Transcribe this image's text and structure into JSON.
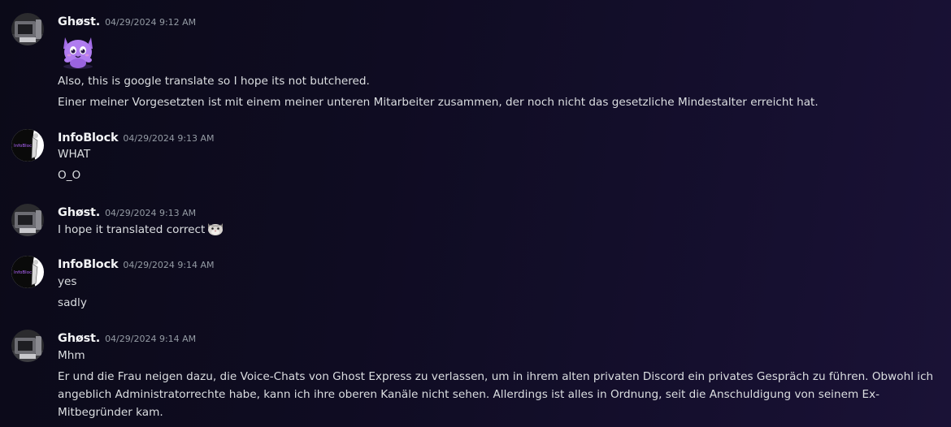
{
  "messages": [
    {
      "author": "Ghøst.",
      "timestamp": "04/29/2024 9:12 AM",
      "sticker": "purple-cat-emoji",
      "lines": [
        "Also, this is google translate so I hope its not butchered.",
        "Einer meiner Vorgesetzten ist mit einem meiner unteren Mitarbeiter zusammen, der noch nicht das gesetzliche Mindestalter erreicht hat."
      ]
    },
    {
      "author": "InfoBlock",
      "timestamp": "04/29/2024 9:13 AM",
      "avatar_text": "InfoBlock",
      "lines": [
        "WHAT",
        "O_O"
      ]
    },
    {
      "author": "Ghøst.",
      "timestamp": "04/29/2024 9:13 AM",
      "lines": [
        "I hope it translated correct"
      ],
      "inline_emoji": "cat-emoji"
    },
    {
      "author": "InfoBlock",
      "timestamp": "04/29/2024 9:14 AM",
      "avatar_text": "InfoBlock",
      "lines": [
        "yes",
        "sadly"
      ]
    },
    {
      "author": "Ghøst.",
      "timestamp": "04/29/2024 9:14 AM",
      "lines": [
        "Mhm",
        "Er und die Frau neigen dazu, die Voice-Chats von Ghost Express zu verlassen, um in ihrem alten privaten Discord ein privates Gespräch zu führen. Obwohl ich angeblich Administratorrechte habe, kann ich ihre oberen Kanäle nicht sehen. Allerdings ist alles in Ordnung, seit die Anschuldigung von seinem Ex-Mitbegründer kam."
      ]
    }
  ],
  "colors": {
    "background": "#0f0c22",
    "username": "#f2f3f5",
    "timestamp": "#949ba4",
    "text": "#dbdee1",
    "sticker": "#b07cf0"
  }
}
